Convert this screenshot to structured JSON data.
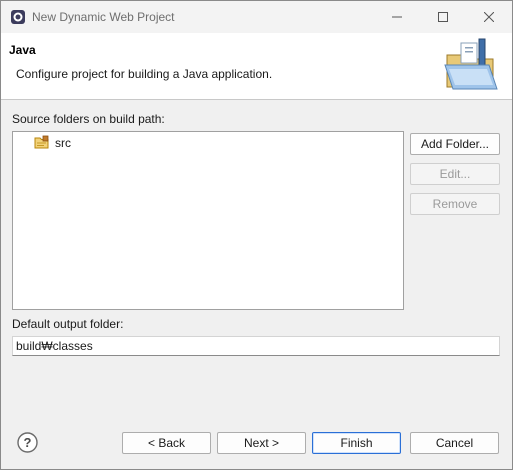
{
  "window": {
    "title": "New Dynamic Web Project",
    "minimize_icon": "minimize-icon",
    "maximize_icon": "maximize-icon",
    "close_icon": "close-icon"
  },
  "header": {
    "title": "Java",
    "description": "Configure project for building a Java application.",
    "banner_icon": "folder-wizard-banner-icon"
  },
  "source": {
    "label": "Source folders on build path:",
    "items": [
      {
        "label": "src",
        "icon": "source-folder-icon"
      }
    ],
    "buttons": {
      "add": "Add Folder...",
      "edit": "Edit...",
      "remove": "Remove"
    }
  },
  "output": {
    "label": "Default output folder:",
    "value": "build₩classes"
  },
  "footer": {
    "help_icon": "help-icon",
    "back": "< Back",
    "next": "Next >",
    "finish": "Finish",
    "cancel": "Cancel"
  },
  "colors": {
    "default_button_border": "#2a6fd6",
    "header_background": "#ffffff",
    "dialog_background": "#f0f0f0"
  }
}
